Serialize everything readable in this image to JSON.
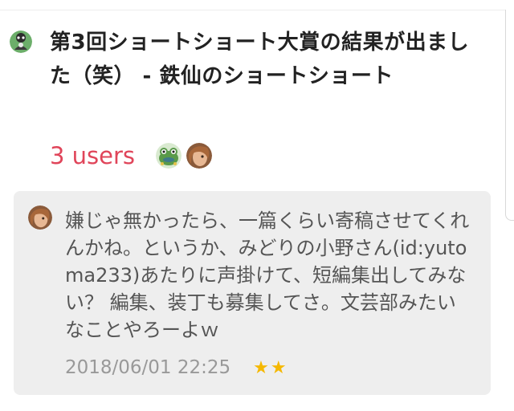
{
  "entry": {
    "title": "第3回ショートショート大賞の結果が出ました（笑） - 鉄仙のショートショート",
    "users_count": "3 users",
    "user_avatars": [
      "frog-avatar",
      "person-avatar"
    ]
  },
  "comment": {
    "text": "嫌じゃ無かったら、一篇くらい寄稿させてくれんかね。というか、みどりの小野さん(id:yutoma233)あたりに声掛けて、短編集出してみない？ 編集、装丁も募集してさ。文芸部みたいなことやろーよｗ",
    "date": "2018/06/01 22:25",
    "stars": "★★",
    "star_count": 2
  },
  "colors": {
    "users_accent": "#e0455a",
    "star": "#f5b800",
    "card_bg": "#eeeeee"
  }
}
